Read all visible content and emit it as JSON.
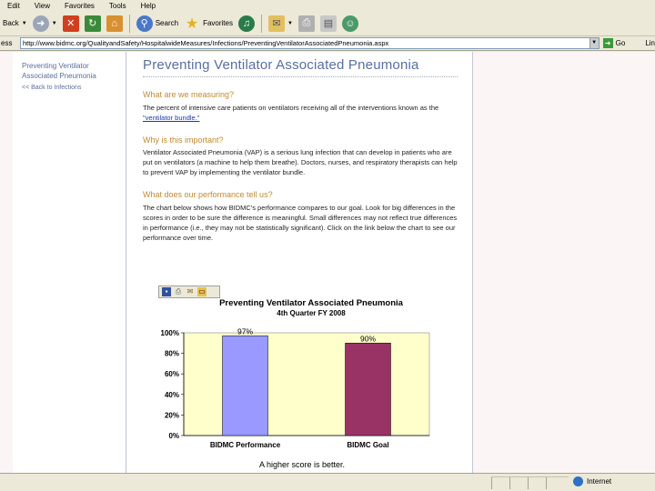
{
  "menu": [
    "Edit",
    "View",
    "Favorites",
    "Tools",
    "Help"
  ],
  "toolbar": {
    "back_label": "Back",
    "search_label": "Search",
    "favorites_label": "Favorites"
  },
  "address": {
    "label": "ess",
    "url": "http://www.bidmc.org/QualityandSafety/HospitalwideMeasures/Infections/PreventingVentilatorAssociatedPneumonia.aspx",
    "go_label": "Go",
    "links_label": "Lin"
  },
  "leftnav": {
    "current": "Preventing Ventilator Associated Pneumonia",
    "back": "<< Back to Infections"
  },
  "page": {
    "title": "Preventing Ventilator Associated Pneumonia",
    "sections": [
      {
        "heading": "What are we measuring?",
        "text_before": "The percent of intensive care patients on ventilators receiving all of the interventions known as the ",
        "link": "\"ventilator bundle.\""
      },
      {
        "heading": "Why is this important?",
        "text": "Ventilator Associated Pneumonia (VAP) is a serious lung infection that can develop in patients who are put on ventilators (a machine to help them breathe). Doctors, nurses, and respiratory therapists can help to prevent VAP by implementing the ventilator bundle."
      },
      {
        "heading": "What does our performance tell us?",
        "text": "The chart below shows how BIDMC's performance compares to our goal. Look for big differences in the scores in order to be sure the difference is meaningful. Small differences may not reflect true differences in performance (i.e., they may not be statistically significant). Click on the link below the chart to see our performance over time."
      }
    ]
  },
  "chart_data": {
    "type": "bar",
    "title": "Preventing Ventilator Associated Pneumonia",
    "subtitle": "4th Quarter FY 2008",
    "categories": [
      "BIDMC Performance",
      "BIDMC Goal"
    ],
    "values": [
      97,
      90
    ],
    "data_labels": [
      "97%",
      "90%"
    ],
    "colors": [
      "#9999ff",
      "#993366"
    ],
    "ylim": [
      0,
      100
    ],
    "yticks": [
      "0%",
      "20%",
      "40%",
      "60%",
      "80%",
      "100%"
    ],
    "plot_bg": "#ffffcc",
    "note": "A higher score is better."
  },
  "status": {
    "zone": "Internet"
  }
}
